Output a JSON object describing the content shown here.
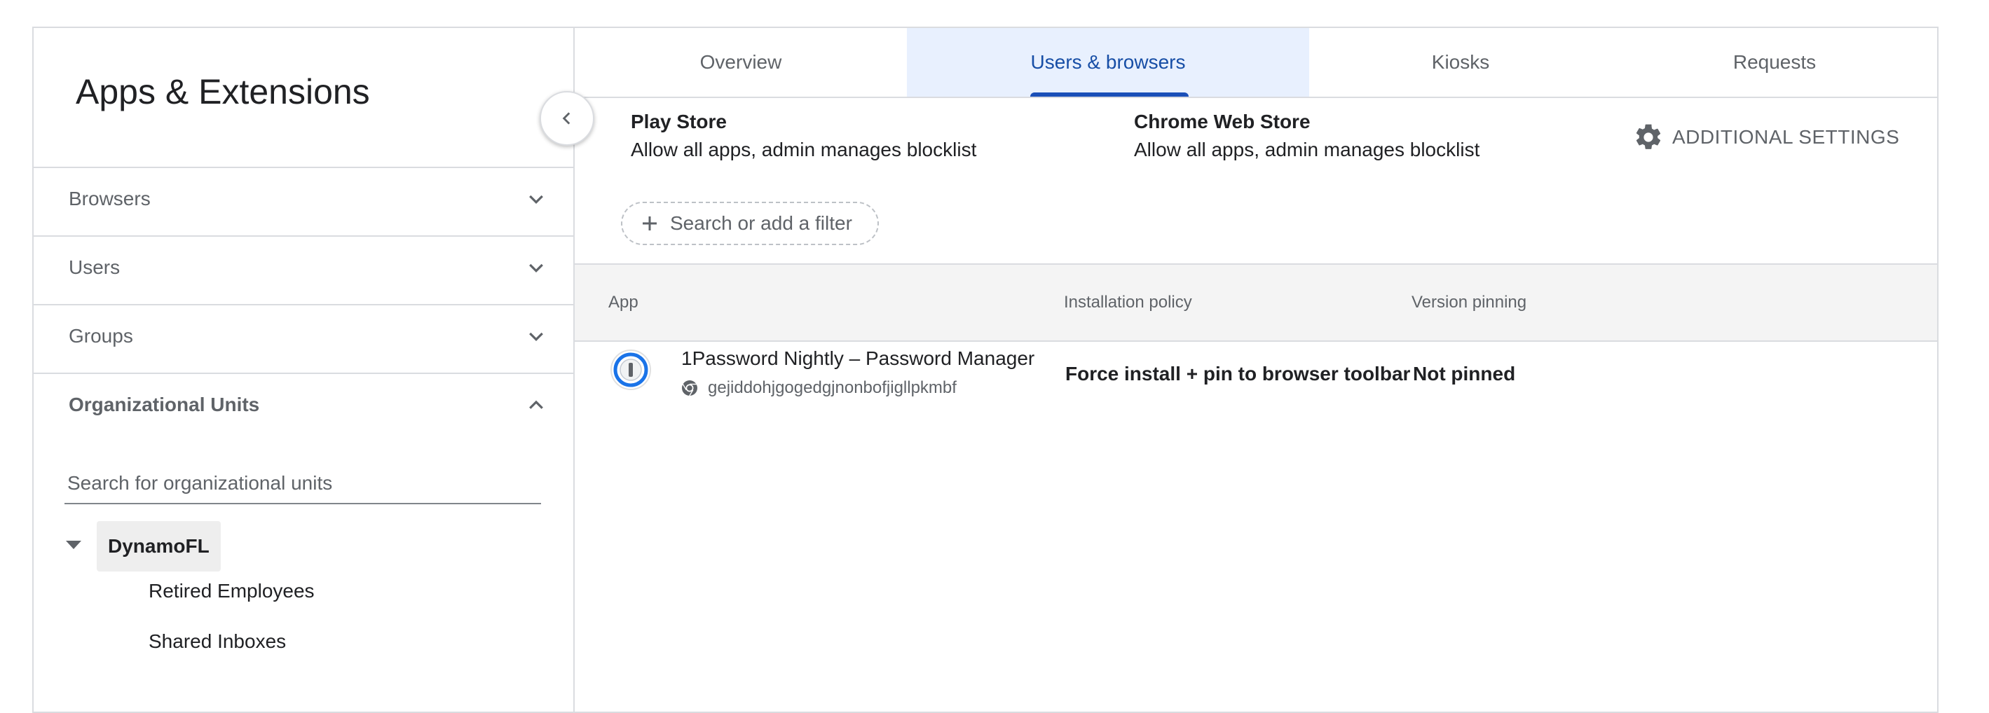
{
  "sidebar": {
    "title": "Apps & Extensions",
    "sections": [
      {
        "label": "Browsers",
        "expanded": false
      },
      {
        "label": "Users",
        "expanded": false
      },
      {
        "label": "Groups",
        "expanded": false
      },
      {
        "label": "Organizational Units",
        "expanded": true
      }
    ],
    "ou_search_placeholder": "Search for organizational units",
    "tree": {
      "root": "DynamoFL",
      "children": [
        "Retired Employees",
        "Shared Inboxes"
      ]
    }
  },
  "main": {
    "tabs": [
      {
        "label": "Overview",
        "active": false
      },
      {
        "label": "Users & browsers",
        "active": true
      },
      {
        "label": "Kiosks",
        "active": false
      },
      {
        "label": "Requests",
        "active": false
      }
    ],
    "play_store": {
      "title": "Play Store",
      "policy": "Allow all apps, admin manages blocklist"
    },
    "chrome_web_store": {
      "title": "Chrome Web Store",
      "policy": "Allow all apps, admin manages blocklist"
    },
    "additional_settings_label": "ADDITIONAL SETTINGS",
    "filter_placeholder": "Search or add a filter",
    "table": {
      "columns": [
        "App",
        "Installation policy",
        "Version pinning"
      ],
      "rows": [
        {
          "app_name": "1Password Nightly – Password Manager",
          "app_id": "gejiddohjgogedgjnonbofjigllpkmbf",
          "installation_policy": "Force install + pin to browser toolbar",
          "version_pinning": "Not pinned"
        }
      ]
    }
  },
  "colors": {
    "accent": "#174ea6",
    "active_tab_bg": "#e8f0fe",
    "border": "#dadce0",
    "muted_text": "#5f6368",
    "header_bg": "#f4f4f4"
  },
  "icons": {
    "collapse": "chevron-left-icon",
    "expand": "chevron-down-icon",
    "collapse_section": "chevron-up-icon",
    "settings": "gear-icon",
    "add_filter": "plus-icon",
    "tree_toggle": "caret-down-icon",
    "app": "1password-icon",
    "source": "chrome-icon"
  }
}
